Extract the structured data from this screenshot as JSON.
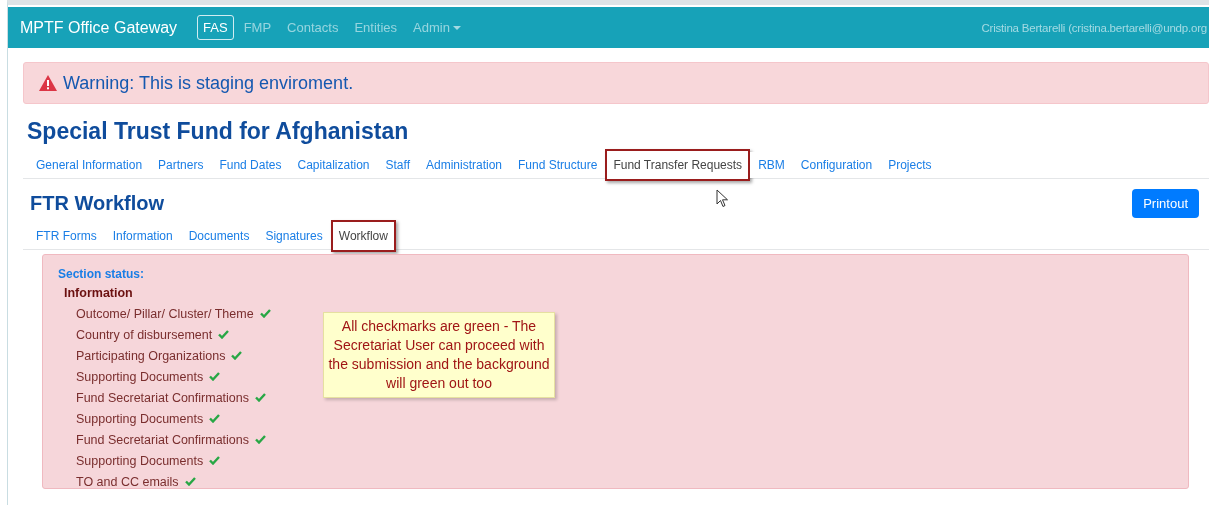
{
  "navbar": {
    "brand": "MPTF Office Gateway",
    "items": [
      {
        "label": "FAS",
        "selected": true
      },
      {
        "label": "FMP",
        "selected": false
      },
      {
        "label": "Contacts",
        "selected": false
      },
      {
        "label": "Entities",
        "selected": false
      },
      {
        "label": "Admin",
        "selected": false,
        "dropdown": true
      }
    ],
    "user": "Cristina Bertarelli (cristina.bertarelli@undp.org"
  },
  "warning": "Warning: This is staging enviroment.",
  "page_title": "Special Trust Fund for Afghanistan",
  "main_tabs": [
    {
      "label": "General Information",
      "selected": false,
      "annotated": false
    },
    {
      "label": "Partners",
      "selected": false,
      "annotated": false
    },
    {
      "label": "Fund Dates",
      "selected": false,
      "annotated": false
    },
    {
      "label": "Capitalization",
      "selected": false,
      "annotated": false
    },
    {
      "label": "Staff",
      "selected": false,
      "annotated": false
    },
    {
      "label": "Administration",
      "selected": false,
      "annotated": false
    },
    {
      "label": "Fund Structure",
      "selected": false,
      "annotated": false
    },
    {
      "label": "Fund Transfer Requests",
      "selected": true,
      "annotated": true
    },
    {
      "label": "RBM",
      "selected": false,
      "annotated": false
    },
    {
      "label": "Configuration",
      "selected": false,
      "annotated": false
    },
    {
      "label": "Projects",
      "selected": false,
      "annotated": false
    }
  ],
  "section_title": "FTR Workflow",
  "printout_button": "Printout",
  "sub_tabs": [
    {
      "label": "FTR Forms",
      "selected": false,
      "annotated": false
    },
    {
      "label": "Information",
      "selected": false,
      "annotated": false
    },
    {
      "label": "Documents",
      "selected": false,
      "annotated": false
    },
    {
      "label": "Signatures",
      "selected": false,
      "annotated": false
    },
    {
      "label": "Workflow",
      "selected": true,
      "annotated": true
    }
  ],
  "status_panel": {
    "heading": "Section status:",
    "group": "Information",
    "items": [
      {
        "label": "Outcome/ Pillar/ Cluster/ Theme",
        "checked": true
      },
      {
        "label": "Country of disbursement",
        "checked": true
      },
      {
        "label": "Participating Organizations",
        "checked": true
      },
      {
        "label": "Supporting Documents",
        "checked": true
      },
      {
        "label": "Fund Secretariat Confirmations",
        "checked": true
      },
      {
        "label": "Supporting Documents",
        "checked": true
      },
      {
        "label": "Fund Secretariat Confirmations",
        "checked": true
      },
      {
        "label": "Supporting Documents",
        "checked": true
      },
      {
        "label": "TO and CC emails",
        "checked": true
      }
    ]
  },
  "callout": "All checkmarks are green - The Secretariat User can proceed with the submission and the background will green out too"
}
